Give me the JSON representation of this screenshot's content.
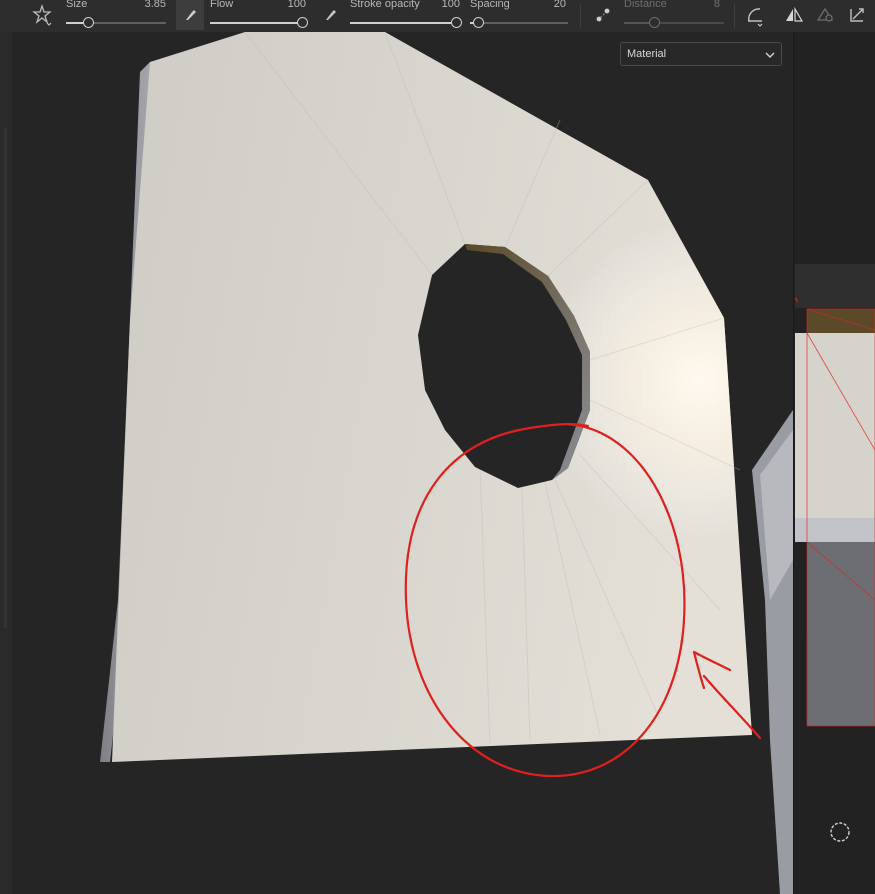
{
  "toolbar": {
    "size": {
      "label": "Size",
      "value": "3.85",
      "fraction": 0.22
    },
    "flow": {
      "label": "Flow",
      "value": "100",
      "fraction": 1.0
    },
    "stroke_opacity": {
      "label": "Stroke opacity",
      "value": "100",
      "fraction": 1.0
    },
    "spacing": {
      "label": "Spacing",
      "value": "20",
      "fraction": 0.08
    },
    "distance": {
      "label": "Distance",
      "value": "8",
      "fraction": 0.3,
      "disabled": true
    }
  },
  "icons": {
    "tool": "brush-tool-icon",
    "flow_pen": "flow-pen-icon",
    "stroke_pen": "pen-icon",
    "spacing_mode": "dots-spacing-icon",
    "lazy_mouse": "lazy-mouse-icon",
    "symmetry": "symmetry-icon",
    "fill": "fill-icon",
    "transform": "transform-icon",
    "camera": "camera-circle-icon"
  },
  "viewport": {
    "channel_select": {
      "value": "Material"
    }
  },
  "colors": {
    "annotation": "#e0201f",
    "mesh_light": "#f4f1ea",
    "mesh_shadow": "#b9b6b0"
  }
}
